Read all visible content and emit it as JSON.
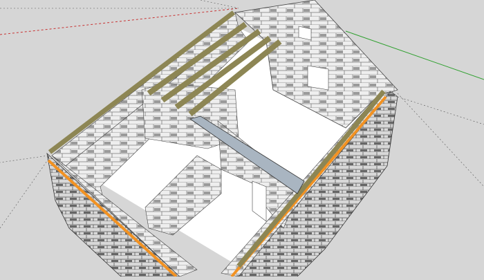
{
  "viewport": {
    "background_color": "#d6d6d6",
    "axis_colors": {
      "red": "#c83232",
      "green": "#2fa02f",
      "guide": "#555555"
    },
    "materials": {
      "block_light": "#f2f2f2",
      "block_mid": "#cfcfcf",
      "block_dark": "#8a8a8a",
      "floor": "#ffffff",
      "timber": "#8d8654",
      "timber_dark": "#5e5a36",
      "orange_band": "#f29222",
      "steel_beam": "#a9b5c1"
    }
  }
}
